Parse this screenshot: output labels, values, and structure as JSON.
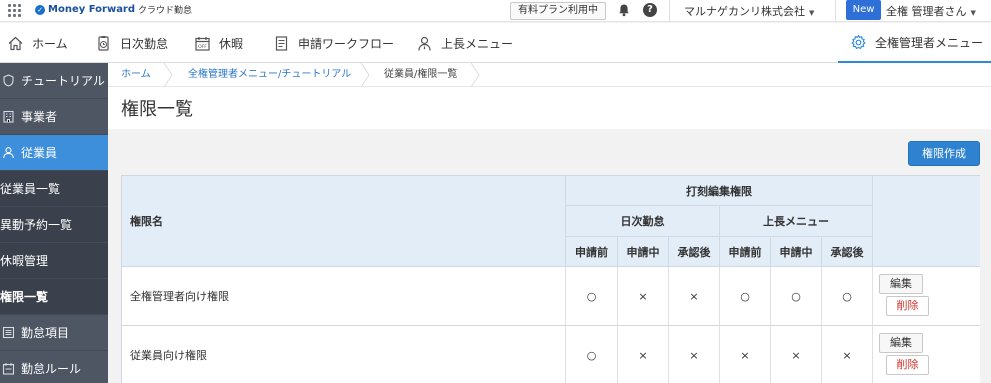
{
  "topbar": {
    "brand": "Money Forward",
    "product": "クラウド勤怠",
    "plan_button": "有料プラン利用中",
    "help": "?",
    "company": "マルナゲカンリ株式会社",
    "new_badge": "New",
    "user": "全権 管理者さん"
  },
  "nav": {
    "items": [
      {
        "label": "ホーム",
        "icon": "home-icon"
      },
      {
        "label": "日次勤怠",
        "icon": "clock-icon"
      },
      {
        "label": "休暇",
        "icon": "calendar-off-icon"
      },
      {
        "label": "申請ワークフロー",
        "icon": "document-icon"
      },
      {
        "label": "上長メニュー",
        "icon": "person-icon"
      },
      {
        "label": "全権管理者メニュー",
        "icon": "gear-icon"
      }
    ]
  },
  "sidebar": {
    "items": [
      {
        "label": "チュートリアル",
        "icon": "shield-icon"
      },
      {
        "label": "事業者",
        "icon": "building-icon"
      },
      {
        "label": "従業員",
        "icon": "user-icon"
      },
      {
        "label": "従業員一覧"
      },
      {
        "label": "異動予約一覧"
      },
      {
        "label": "休暇管理"
      },
      {
        "label": "権限一覧"
      },
      {
        "label": "勤怠項目",
        "icon": "list-icon"
      },
      {
        "label": "勤怠ルール",
        "icon": "rule-icon"
      }
    ]
  },
  "breadcrumb": {
    "home": "ホーム",
    "parent": "全権管理者メニュー/チュートリアル",
    "current": "従業員/権限一覧"
  },
  "page": {
    "title": "権限一覧",
    "create_button": "権限作成"
  },
  "table": {
    "header_name": "権限名",
    "header_group": "打刻編集権限",
    "subgroups": [
      "日次勤怠",
      "上長メニュー"
    ],
    "states": [
      "申請前",
      "申請中",
      "承認後",
      "申請前",
      "申請中",
      "承認後"
    ],
    "rows": [
      {
        "name": "全権管理者向け権限",
        "values": [
          "○",
          "×",
          "×",
          "○",
          "○",
          "○"
        ],
        "edit": "編集",
        "delete": "削除"
      },
      {
        "name": "従業員向け権限",
        "values": [
          "○",
          "×",
          "×",
          "×",
          "×",
          "×"
        ],
        "edit": "編集",
        "delete": "削除"
      }
    ]
  },
  "colors": {
    "accent": "#2e82cf",
    "sidebar": "#4e5563",
    "sidebar_active": "#3d8fdb",
    "table_header": "#e3edf8",
    "delete_text": "#d0342c"
  }
}
